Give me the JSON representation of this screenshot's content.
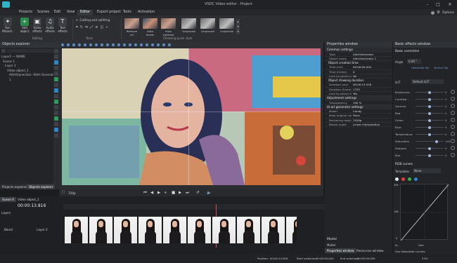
{
  "app": {
    "title": "VSDC Video editor - Project"
  },
  "menu": [
    "Projects",
    "Scenes",
    "Edit",
    "View",
    "Editor",
    "Export project",
    "Tools",
    "Activation"
  ],
  "menu_active_index": 4,
  "options_label": "Options",
  "toolbar": {
    "buttons": [
      {
        "label": "Run Wizard...",
        "icon": "wizard-icon"
      },
      {
        "label": "Add object",
        "icon": "add-object-icon"
      },
      {
        "label": "Video effects",
        "icon": "video-effects-icon"
      },
      {
        "label": "Audio effects",
        "icon": "audio-effects-icon"
      },
      {
        "label": "Text effects",
        "icon": "text-effects-icon"
      }
    ],
    "editing_label": "Editing",
    "cut_split_label": "Cutting and splitting",
    "tools_label": "Tools",
    "style_label": "Choosing quick style",
    "filters": [
      "Remove all",
      "Auto levels",
      "Auto contrast",
      "Grayscale",
      "Grayscale",
      "Grayscale"
    ]
  },
  "objects_explorer": {
    "title": "Objects explorer",
    "tree": [
      "Layer1 — NAWE",
      "Scene 1",
      "Layer 1",
      "Video object_1",
      "AIArtGenerator: AIArt Generator 1"
    ],
    "tabs": [
      "Projects explorer",
      "Objects explorer"
    ]
  },
  "properties": {
    "title": "Properties window",
    "common_settings": "Common settings",
    "rows_common": [
      [
        "Type",
        "AIArtGenerator"
      ],
      [
        "Object name",
        "AIArtGenerator 1"
      ]
    ],
    "creation_time": "Object creation time",
    "rows_time": [
      [
        "Time (ms)",
        "00:00:00.000"
      ],
      [
        "Time (frame)",
        "0"
      ],
      [
        "Lock to parent dr",
        "No"
      ]
    ],
    "drawing_duration": "Object drawing duration",
    "rows_duration": [
      [
        "Duration (ms)",
        "00:00:15.916"
      ],
      [
        "Duration (frame)",
        "1703"
      ],
      [
        "Lock to parent dr",
        "Yes"
      ]
    ],
    "adjustment": "Adjustment settings",
    "rows_adjust": [
      [
        "Transparency",
        "100 %"
      ]
    ],
    "ai_settings": "AI art generator settings",
    "rows_ai": [
      [
        "Model",
        "Candy"
      ],
      [
        "Keep original colors",
        "False"
      ],
      [
        "Rendering resolution",
        "1920p"
      ],
      [
        "Resize mode",
        "Linear interpolation"
      ]
    ],
    "footer_label": "Model",
    "footer_sub": "Model",
    "bottom_tabs": [
      "Properties window",
      "Resources window"
    ]
  },
  "effects": {
    "title": "Basic effects window",
    "basic_correction": "Basic correction",
    "angle_label": "Angle",
    "angle_value": "0.00 °",
    "flip_h": "Horizontal flip",
    "flip_v": "Vertical flip",
    "lut_label": "LUT",
    "lut_value": "Default LUT",
    "sliders": [
      {
        "label": "Brightness",
        "value": "0",
        "pos": 0.5
      },
      {
        "label": "Contrast",
        "value": "0",
        "pos": 0.5
      },
      {
        "label": "Gamma",
        "value": "0",
        "pos": 0.5
      },
      {
        "label": "Red",
        "value": "0",
        "pos": 0.5
      },
      {
        "label": "Green",
        "value": "0",
        "pos": 0.5
      },
      {
        "label": "Blue",
        "value": "0",
        "pos": 0.5
      },
      {
        "label": "Temperature",
        "value": "0",
        "pos": 0.5
      },
      {
        "label": "Saturation",
        "value": "100",
        "pos": 0.75
      },
      {
        "label": "Sharpen",
        "value": "0",
        "pos": 0.5
      },
      {
        "label": "Blur",
        "value": "0",
        "pos": 0.5
      }
    ],
    "rgb_curves": "RGB curves",
    "templates_label": "Templates",
    "templates_value": "None",
    "curve_labels": [
      "255",
      "128",
      "0",
      "In:",
      "Out:"
    ],
    "hue_sat": "Hue Saturation curves"
  },
  "timeline": {
    "tabs": [
      "Scene 0",
      "Video object_1"
    ],
    "timecode": "00:00:13.816",
    "zoom": "720p",
    "layer_name": "Layer 2",
    "blend_mode": "Blend",
    "layer_col": "Layers"
  },
  "status": {
    "position_label": "Position:",
    "position": "00:00:13.816",
    "start_sel_label": "Start selection:",
    "start_sel": "00:00:00.000",
    "end_sel_label": "End selection:",
    "end_sel": "00:00:00.000",
    "zoom": "23%"
  }
}
